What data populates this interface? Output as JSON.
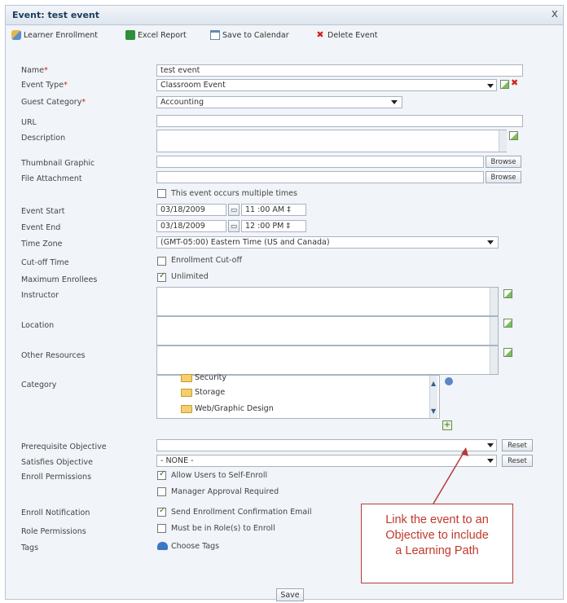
{
  "window": {
    "title": "Event: test event",
    "close": "x"
  },
  "toolbar": {
    "learner_enrollment": "Learner Enrollment",
    "excel_report": "Excel Report",
    "save_calendar": "Save to Calendar",
    "delete_event": "Delete Event"
  },
  "form": {
    "name_label": "Name",
    "name_value": "test event",
    "event_type_label": "Event Type",
    "event_type_value": "Classroom Event",
    "guest_category_label": "Guest Category",
    "guest_category_value": "Accounting",
    "url_label": "URL",
    "description_label": "Description",
    "thumbnail_label": "Thumbnail Graphic",
    "file_attachment_label": "File Attachment",
    "browse": "Browse",
    "multi_label": "This event occurs multiple times",
    "event_start_label": "Event Start",
    "event_start_date": "03/18/2009",
    "event_start_time": "11 :00  AM ‡",
    "event_end_label": "Event End",
    "event_end_date": "03/18/2009",
    "event_end_time": "12 :00  PM ‡",
    "timezone_label": "Time Zone",
    "timezone_value": "(GMT-05:00) Eastern Time (US and Canada)",
    "cutoff_label": "Cut-off Time",
    "cutoff_check": "Enrollment Cut-off",
    "max_label": "Maximum Enrollees",
    "max_check": "Unlimited",
    "instructor_label": "Instructor",
    "location_label": "Location",
    "other_resources_label": "Other Resources",
    "category_label": "Category",
    "category_items": [
      "Security",
      "Storage",
      "Web/Graphic Design"
    ],
    "prereq_label": "Prerequisite Objective",
    "prereq_value": "",
    "reset": "Reset",
    "satisfies_label": "Satisfies Objective",
    "satisfies_value": "- NONE -",
    "enroll_perm_label": "Enroll Permissions",
    "allow_self": "Allow Users to Self-Enroll",
    "mgr_approval": "Manager Approval Required",
    "enroll_notif_label": "Enroll Notification",
    "send_email": "Send Enrollment Confirmation Email",
    "role_perm_label": "Role Permissions",
    "role_check": "Must be in Role(s) to Enroll",
    "tags_label": "Tags",
    "choose_tags": "Choose Tags",
    "save": "Save"
  },
  "callout": {
    "lines": [
      "Link the event to an",
      "Objective to include",
      "a Learning Path"
    ]
  },
  "colors": {
    "accent": "#1c3b5c",
    "required": "#d02020",
    "callout": "#c0392b"
  }
}
